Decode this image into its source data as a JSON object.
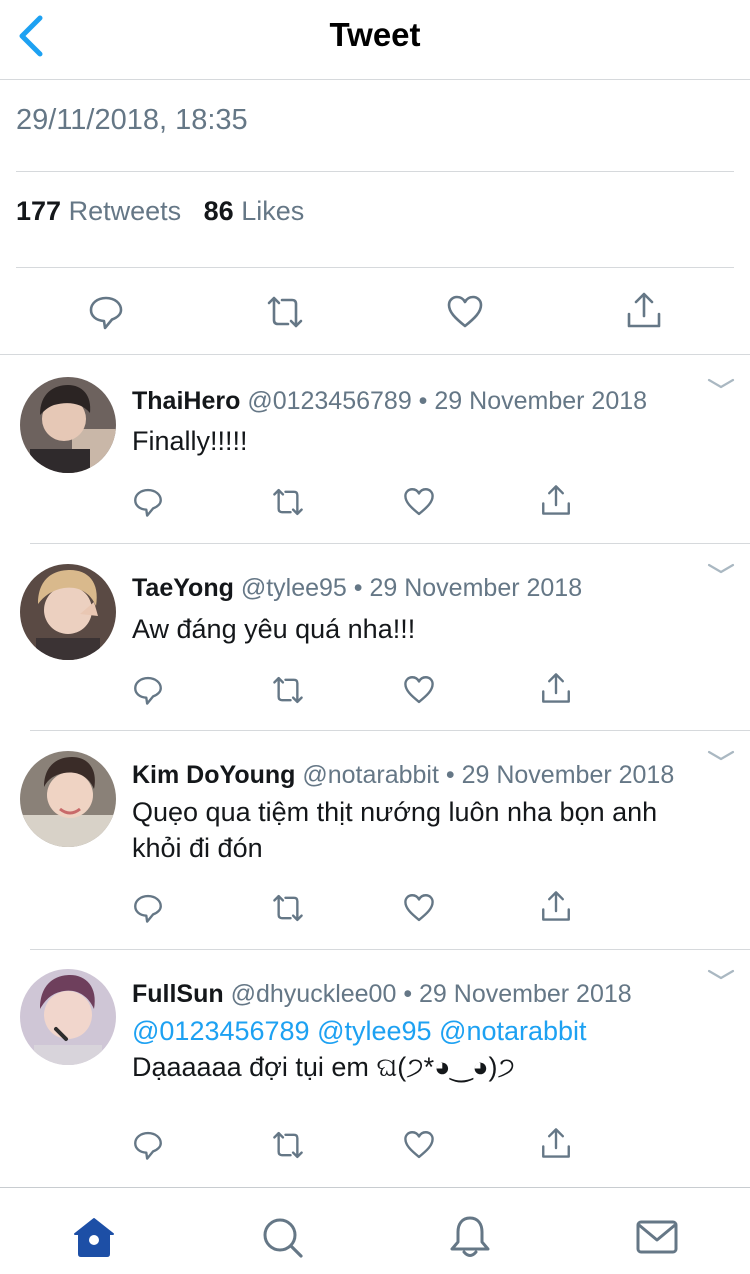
{
  "header": {
    "title": "Tweet"
  },
  "tweet": {
    "timestamp": "29/11/2018, 18:35",
    "retweets_count": "177",
    "retweets_label": "Retweets",
    "likes_count": "86",
    "likes_label": "Likes"
  },
  "replies": [
    {
      "name": "ThaiHero",
      "handle": "@0123456789",
      "date": "29 November 2018",
      "text": "Finally!!!!!"
    },
    {
      "name": "TaeYong",
      "handle": "@tylee95",
      "date": "29 November 2018",
      "text": "Aw đáng yêu quá nha!!!"
    },
    {
      "name": "Kim DoYoung",
      "handle": "@notarabbit",
      "date": "29 November 2018",
      "text": "Quẹo qua tiệm thịt nướng luôn nha bọn anh khỏi đi đón"
    },
    {
      "name": "FullSun",
      "handle": "@dhyucklee00",
      "date": "29 November 2018",
      "mentions": "@0123456789 @tylee95 @notarabbit",
      "text": "Dạaaaaa đợi tụi em ଘ(੭*◕‿◕)੭"
    }
  ],
  "separator": " • ",
  "colors": {
    "accent": "#1da1f2",
    "secondary_text": "#657786",
    "divider": "#d6d9dc",
    "tab_active": "#1d4fa6"
  },
  "icons": {
    "header": "back-chevron-icon",
    "actions": [
      "reply-icon",
      "retweet-icon",
      "like-icon",
      "share-icon"
    ],
    "tabs": [
      "home-icon",
      "search-icon",
      "notifications-icon",
      "messages-icon"
    ]
  }
}
